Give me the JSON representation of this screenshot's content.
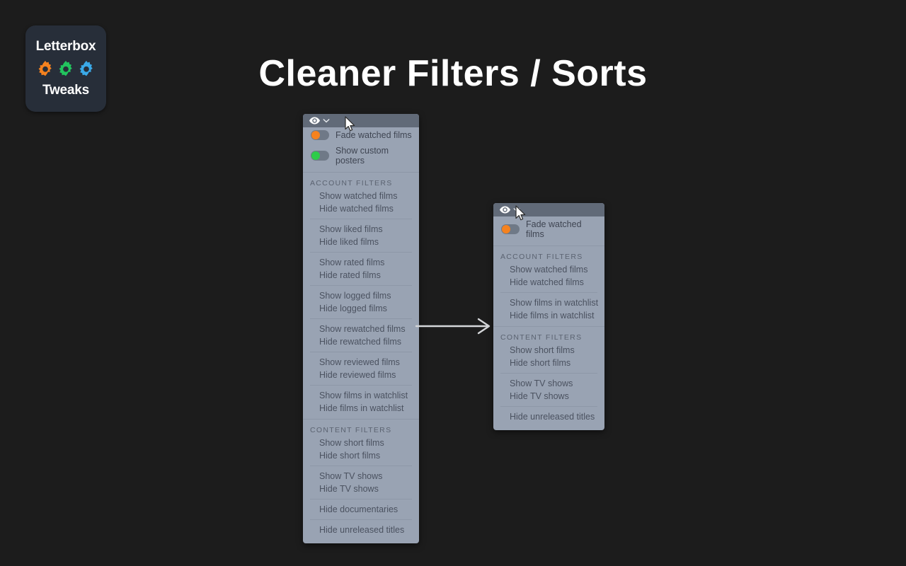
{
  "background_color": "#1c1c1c",
  "logo": {
    "line1": "Letterbox",
    "line2": "Tweaks",
    "badge_color": "#272e39",
    "gear_colors": [
      "#f5821f",
      "#22c55e",
      "#3aa9e8"
    ],
    "gear_icon_names": [
      "gear-icon-orange",
      "gear-icon-green",
      "gear-icon-blue"
    ]
  },
  "header": {
    "title": "Cleaner Filters / Sorts"
  },
  "arrow": {
    "icon_name": "flow-arrow-icon",
    "color": "#d5d7da"
  },
  "panels": {
    "before": {
      "name": "before-panel",
      "header_icons": [
        "eye-icon",
        "chevron-down-icon"
      ],
      "toggles": [
        {
          "label": "Fade watched films",
          "knob_color": "#f5821f",
          "state": "off"
        },
        {
          "label": "Show custom posters",
          "knob_color": "#2ecc4a",
          "state": "off"
        }
      ],
      "sections": [
        {
          "heading": "ACCOUNT FILTERS",
          "groups": [
            [
              "Show watched films",
              "Hide watched films"
            ],
            [
              "Show liked films",
              "Hide liked films"
            ],
            [
              "Show rated films",
              "Hide rated films"
            ],
            [
              "Show logged films",
              "Hide logged films"
            ],
            [
              "Show rewatched films",
              "Hide rewatched films"
            ],
            [
              "Show reviewed films",
              "Hide reviewed films"
            ],
            [
              "Show films in watchlist",
              "Hide films in watchlist"
            ]
          ]
        },
        {
          "heading": "CONTENT FILTERS",
          "groups": [
            [
              "Show short films",
              "Hide short films"
            ],
            [
              "Show TV shows",
              "Hide TV shows"
            ],
            [
              "Hide documentaries"
            ],
            [
              "Hide unreleased titles"
            ]
          ]
        }
      ]
    },
    "after": {
      "name": "after-panel",
      "header_icons": [
        "eye-icon",
        "chevron-down-icon"
      ],
      "toggles": [
        {
          "label": "Fade watched films",
          "knob_color": "#f5821f",
          "state": "off"
        }
      ],
      "sections": [
        {
          "heading": "ACCOUNT FILTERS",
          "groups": [
            [
              "Show watched films",
              "Hide watched films"
            ],
            [
              "Show films in watchlist",
              "Hide films in watchlist"
            ]
          ]
        },
        {
          "heading": "CONTENT FILTERS",
          "groups": [
            [
              "Show short films",
              "Hide short films"
            ],
            [
              "Show TV shows",
              "Hide TV shows"
            ],
            [
              "Hide unreleased titles"
            ]
          ]
        }
      ]
    }
  },
  "colors": {
    "panel_body": "#99a3b3",
    "panel_header": "#616a78",
    "separator": "#8d97a7",
    "menu_text": "#4b5260",
    "section_text": "#5b6371",
    "title_text": "#ffffff"
  }
}
